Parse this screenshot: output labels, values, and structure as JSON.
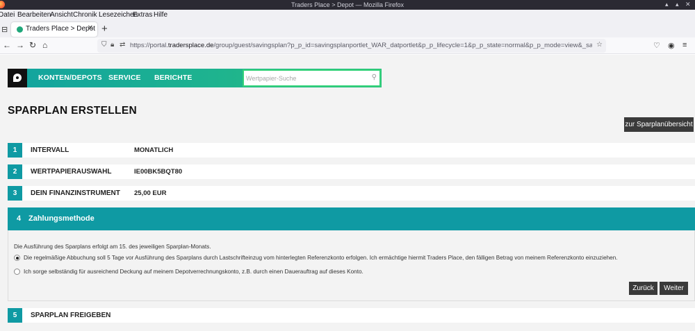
{
  "browser": {
    "window_title": "Traders Place > Depot — Mozilla Firefox",
    "menu": [
      "Datei",
      "Bearbeiten",
      "Ansicht",
      "Chronik",
      "Lesezeichen",
      "Extras",
      "Hilfe"
    ],
    "tab_title": "Traders Place > Depot",
    "url_prefix": "https://portal.",
    "url_domain": "tradersplace.de",
    "url_rest": "/group/guest/savingsplan?p_p_id=savingsplanportlet_WAR_datportlet&p_p_lifecycle=1&p_p_state=normal&p_p_mode=view&_savingsplanportlet_WAR_da"
  },
  "site_nav": {
    "items": [
      "KONTEN/DEPOTS",
      "SERVICE",
      "BERICHTE"
    ],
    "search_placeholder": "Wertpapier-Suche"
  },
  "page_title": "SPARPLAN ERSTELLEN",
  "overview_button": "zur Sparplanübersicht",
  "steps": [
    {
      "num": "1",
      "label": "INTERVALL",
      "value": "MONATLICH"
    },
    {
      "num": "2",
      "label": "WERTPAPIERAUSWAHL",
      "value": "IE00BK5BQT80"
    },
    {
      "num": "3",
      "label": "DEIN FINANZINSTRUMENT",
      "value": "25,00 EUR"
    },
    {
      "num": "4",
      "label": "Zahlungsmethode"
    },
    {
      "num": "5",
      "label": "SPARPLAN FREIGEBEN"
    }
  ],
  "payment": {
    "intro": "Die Ausführung des Sparplans erfolgt am 15. des jeweiligen Sparplan-Monats.",
    "options": [
      {
        "label": "Die regelmäßige Abbuchung soll 5 Tage vor Ausführung des Sparplans durch Lastschrifteinzug vom hinterlegten Referenzkonto erfolgen. Ich ermächtige hiermit Traders Place, den fälligen Betrag von meinem Referenzkonto einzuziehen.",
        "selected": true
      },
      {
        "label": "Ich sorge selbständig für ausreichend Deckung auf meinem Depotverrechnungskonto, z.B. durch einen Dauerauftrag auf dieses Konto.",
        "selected": false
      }
    ],
    "back_button": "Zurück",
    "next_button": "Weiter"
  },
  "colors": {
    "teal": "#0f9aa3",
    "green": "#28c07a",
    "dark_button": "#3a3a3a"
  }
}
